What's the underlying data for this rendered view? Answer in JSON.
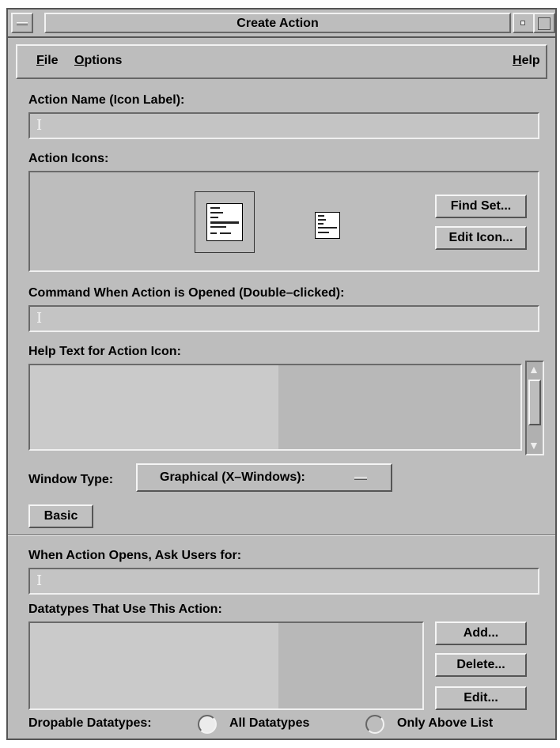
{
  "window": {
    "title": "Create Action"
  },
  "menubar": {
    "file_mnemonic": "F",
    "file_rest": "ile",
    "options_mnemonic": "O",
    "options_rest": "ptions",
    "help_mnemonic": "H",
    "help_rest": "elp"
  },
  "action_name": {
    "label": "Action Name (Icon Label):",
    "value": ""
  },
  "action_icons": {
    "label": "Action Icons:",
    "find_set_button": "Find Set...",
    "edit_icon_button": "Edit Icon..."
  },
  "command": {
    "label": "Command When Action is Opened (Double–clicked):",
    "value": ""
  },
  "help_text": {
    "label": "Help Text for Action Icon:",
    "value": ""
  },
  "window_type": {
    "label": "Window Type:",
    "selected": "Graphical (X–Windows):"
  },
  "basic_button": "Basic",
  "ask_users": {
    "label": "When Action Opens, Ask Users for:",
    "value": ""
  },
  "datatypes": {
    "label": "Datatypes That Use This Action:",
    "add_button": "Add...",
    "delete_button": "Delete...",
    "edit_button": "Edit..."
  },
  "dropable": {
    "label": "Dropable Datatypes:",
    "options": [
      "All Datatypes",
      "Only Above List"
    ],
    "selected": "All Datatypes"
  }
}
